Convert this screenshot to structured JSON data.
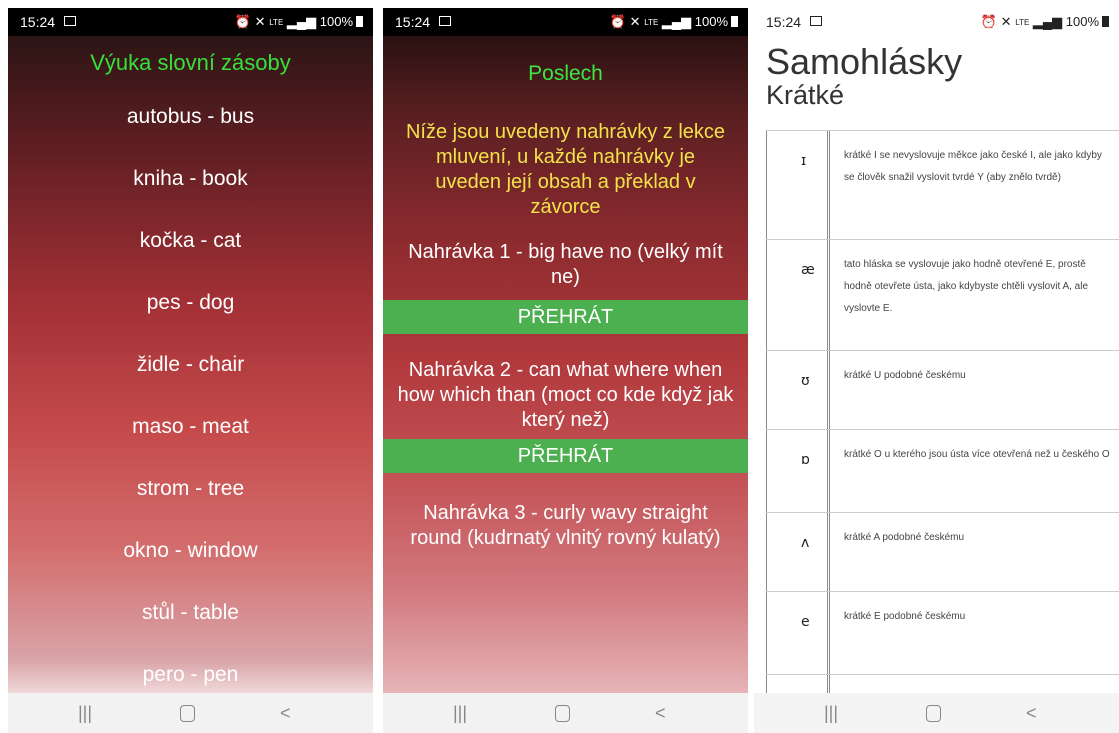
{
  "status": {
    "time": "15:24",
    "battery": "100%",
    "network": "LTE"
  },
  "screen1": {
    "title": "Výuka slovní zásoby",
    "words": [
      "autobus - bus",
      "kniha - book",
      "kočka - cat",
      "pes - dog",
      "židle - chair",
      "maso - meat",
      "strom - tree",
      "okno - window",
      "stůl - table",
      "pero - pen"
    ]
  },
  "screen2": {
    "title": "Poslech",
    "intro": "Níže jsou uvedeny nahrávky z lekce mluvení, u každé nahrávky je uveden její obsah a překlad v závorce",
    "recordings": [
      {
        "text": "Nahrávka 1 - big have no (velký mít ne)",
        "button": "PŘEHRÁT"
      },
      {
        "text": "Nahrávka 2 - can what where when how which than (moct co kde když jak který než)",
        "button": "PŘEHRÁT"
      },
      {
        "text": "Nahrávka 3 - curly wavy straight round (kudrnatý vlnitý rovný kulatý)",
        "button": ""
      }
    ]
  },
  "screen3": {
    "title": "Samohlásky",
    "subtitle": "Krátké",
    "rows": [
      {
        "symbol": "ɪ",
        "desc": "krátké I se nevyslovuje měkce jako české I, ale jako kdyby se člověk snažil vyslovit tvrdé Y (aby znělo tvrdě)"
      },
      {
        "symbol": "æ",
        "desc": "tato hláska se vyslovuje jako hodně otevřené E, prostě hodně otevřete ústa, jako kdybyste chtěli vyslovit A, ale vyslovte E."
      },
      {
        "symbol": "ʊ",
        "desc": "krátké U podobné českému"
      },
      {
        "symbol": "ɒ",
        "desc": "krátké O u kterého jsou ústa více otevřená než u českého O"
      },
      {
        "symbol": "ʌ",
        "desc": "krátké A podobné českému"
      },
      {
        "symbol": "e",
        "desc": "krátké E podobné českému"
      },
      {
        "symbol": "",
        "desc": ""
      }
    ]
  },
  "navbar": {
    "menu": "|||",
    "back": "<"
  }
}
